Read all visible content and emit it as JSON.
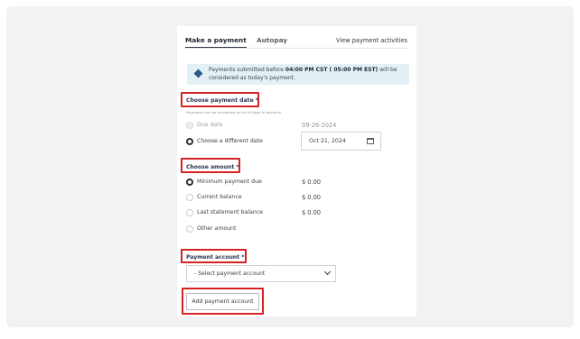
{
  "tabs": {
    "make_payment": "Make a payment",
    "autopay": "Autopay",
    "view_activities": "View payment activities"
  },
  "info_banner": {
    "icon": "info-diamond-icon",
    "text_before": "Payments submitted before ",
    "text_bold": "04:00 PM CST ( 05:00 PM EST)",
    "text_after": " will be considered as today's payment."
  },
  "payment_date": {
    "title": "Choose payment date *",
    "hint": "Payments can be scheduled up to 30 days in advance.",
    "options": [
      {
        "label": "Due date",
        "value": "09-26-2024",
        "selected": false,
        "disabled": true
      },
      {
        "label": "Choose a different date",
        "selected": true,
        "disabled": false
      }
    ],
    "date_input_value": "Oct 21, 2024",
    "calendar_icon": "calendar-icon"
  },
  "amount": {
    "title": "Choose amount *",
    "options": [
      {
        "label": "Minimum payment due",
        "value": "$ 0.00",
        "selected": true
      },
      {
        "label": "Current balance",
        "value": "$ 0.00",
        "selected": false
      },
      {
        "label": "Last statement balance",
        "value": "$ 0.00",
        "selected": false
      },
      {
        "label": "Other amount",
        "selected": false
      }
    ]
  },
  "payment_account": {
    "title": "Payment account *",
    "select_value": "- Select payment account",
    "add_button": "Add payment account"
  },
  "colors": {
    "highlight_box": "#d62222",
    "info_background": "#e3f1f7",
    "info_icon": "#2b5a86",
    "page_background": "#f1f2f4"
  }
}
